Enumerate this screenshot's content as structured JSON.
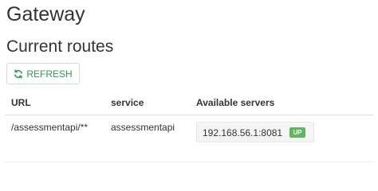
{
  "page": {
    "title": "Gateway",
    "section_title": "Current routes"
  },
  "toolbar": {
    "refresh_label": "REFRESH",
    "refresh_icon": "refresh-icon"
  },
  "colors": {
    "accent_green": "#2a9e52",
    "status_up": "#5cb85c"
  },
  "table": {
    "columns": [
      "URL",
      "service",
      "Available servers"
    ],
    "rows": [
      {
        "url": "/assessmentapi/**",
        "service": "assessmentapi",
        "servers": [
          {
            "address": "192.168.56.1:8081",
            "status": "UP"
          }
        ]
      }
    ]
  }
}
